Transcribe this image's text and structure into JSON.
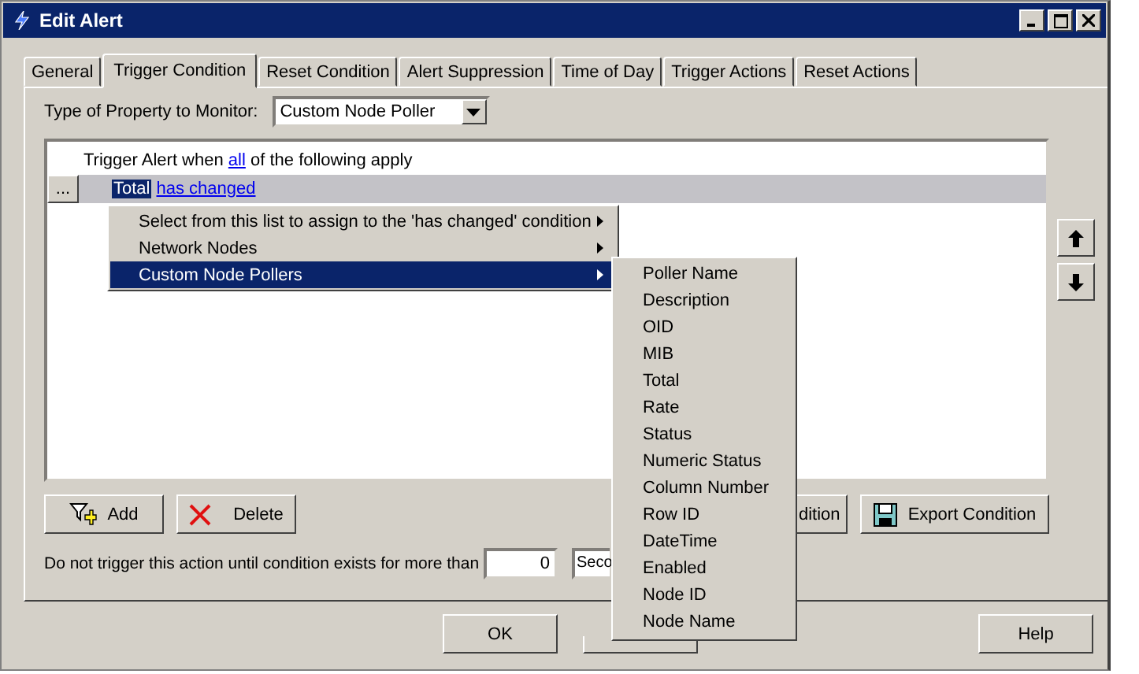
{
  "window": {
    "title": "Edit Alert"
  },
  "tabs": [
    {
      "label": "General",
      "selected": false
    },
    {
      "label": "Trigger Condition",
      "selected": true
    },
    {
      "label": "Reset Condition",
      "selected": false
    },
    {
      "label": "Alert Suppression",
      "selected": false
    },
    {
      "label": "Time of Day",
      "selected": false
    },
    {
      "label": "Trigger Actions",
      "selected": false
    },
    {
      "label": "Reset Actions",
      "selected": false
    }
  ],
  "property_type": {
    "label": "Type of Property to Monitor:",
    "value": "Custom Node Poller"
  },
  "conditions": {
    "header_before": "Trigger Alert when ",
    "header_link": "all",
    "header_after": " of the following apply",
    "row_button": "...",
    "field": "Total",
    "operator": "has changed",
    "selected": true
  },
  "context_menu": [
    {
      "label": "Select from this list to assign to the 'has changed' condition",
      "submenu": true,
      "selected": false
    },
    {
      "label": "Network Nodes",
      "submenu": true,
      "selected": false
    },
    {
      "label": "Custom Node Pollers",
      "submenu": true,
      "selected": true
    }
  ],
  "submenu": [
    "Poller Name",
    "Description",
    "OID",
    "MIB",
    "Total",
    "Rate",
    "Status",
    "Numeric Status",
    "Column Number",
    "Row ID",
    "DateTime",
    "Enabled",
    "Node ID",
    "Node Name"
  ],
  "buttons": {
    "add": "Add",
    "delete": "Delete",
    "import": "dition",
    "export": "Export Condition"
  },
  "delay": {
    "label": "Do not trigger this action until condition exists for more than",
    "value": "0",
    "unit": "Seco"
  },
  "dialog_buttons": {
    "ok": "OK",
    "help": "Help"
  }
}
